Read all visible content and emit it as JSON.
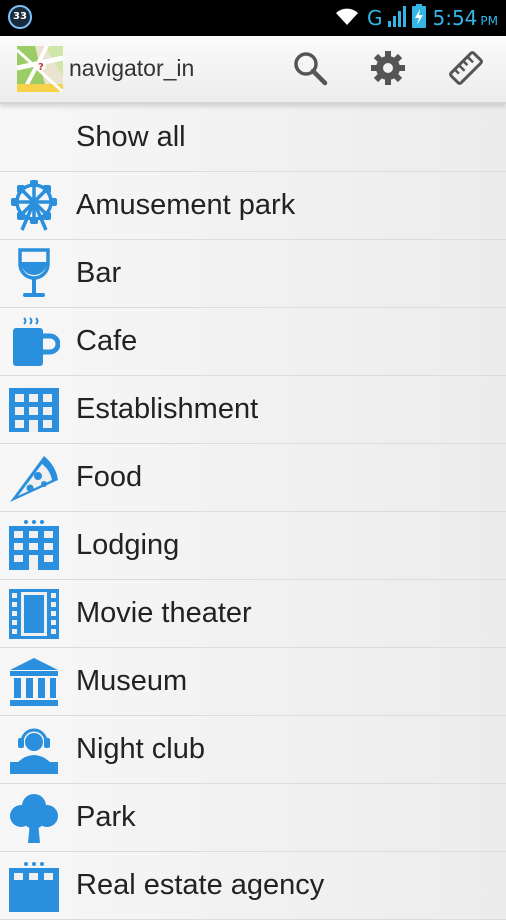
{
  "status_bar": {
    "notification_badge": "33",
    "network": "G",
    "time": "5:54",
    "ampm": "PM",
    "accent_color": "#33b5e5"
  },
  "action_bar": {
    "title": "navigator_in",
    "actions": [
      "search-icon",
      "gear-icon",
      "ruler-icon"
    ]
  },
  "categories": [
    {
      "label": "Show all",
      "icon": "none"
    },
    {
      "label": "Amusement park",
      "icon": "ferris-wheel-icon"
    },
    {
      "label": "Bar",
      "icon": "wine-glass-icon"
    },
    {
      "label": "Cafe",
      "icon": "coffee-cup-icon"
    },
    {
      "label": "Establishment",
      "icon": "building-icon"
    },
    {
      "label": "Food",
      "icon": "pizza-slice-icon"
    },
    {
      "label": "Lodging",
      "icon": "hotel-icon"
    },
    {
      "label": "Movie theater",
      "icon": "film-strip-icon"
    },
    {
      "label": "Museum",
      "icon": "museum-icon"
    },
    {
      "label": "Night club",
      "icon": "dj-icon"
    },
    {
      "label": "Park",
      "icon": "tree-icon"
    },
    {
      "label": "Real estate agency",
      "icon": "real-estate-icon"
    }
  ],
  "icon_color": "#2a8fdc"
}
